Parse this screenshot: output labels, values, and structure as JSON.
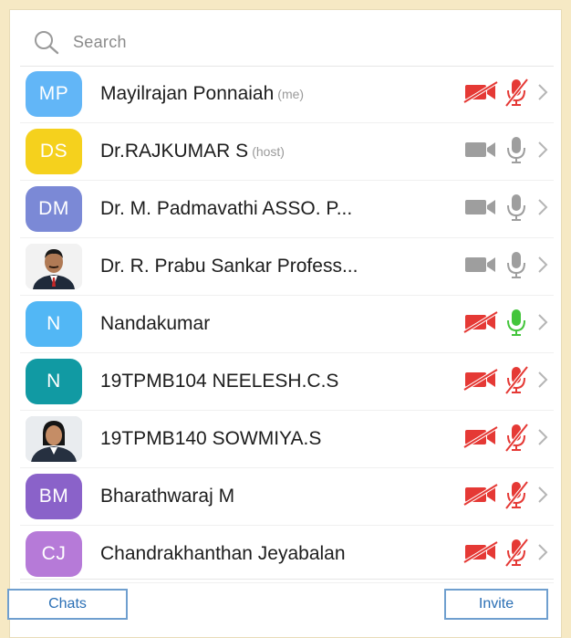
{
  "search": {
    "placeholder": "Search"
  },
  "participants": [
    {
      "initials": "MP",
      "name": "Mayilrajan Ponnaiah",
      "tag": "(me)",
      "avatar_color": "#62b6f7",
      "avatar_type": "initials",
      "video": "off",
      "audio": "muted"
    },
    {
      "initials": "DS",
      "name": "Dr.RAJKUMAR S",
      "tag": "(host)",
      "avatar_color": "#f5d11d",
      "avatar_type": "initials",
      "video": "idle",
      "audio": "idle"
    },
    {
      "initials": "DM",
      "name": "Dr. M. Padmavathi ASSO. P...",
      "tag": "",
      "avatar_color": "#7b89d6",
      "avatar_type": "initials",
      "video": "idle",
      "audio": "idle"
    },
    {
      "initials": "",
      "name": "Dr. R. Prabu Sankar Profess...",
      "tag": "",
      "avatar_color": "#eeeeee",
      "avatar_type": "photo-man",
      "video": "idle",
      "audio": "idle"
    },
    {
      "initials": "N",
      "name": "Nandakumar",
      "tag": "",
      "avatar_color": "#52b7f5",
      "avatar_type": "initials",
      "video": "off",
      "audio": "active"
    },
    {
      "initials": "N",
      "name": "19TPMB104 NEELESH.C.S",
      "tag": "",
      "avatar_color": "#119aa3",
      "avatar_type": "initials",
      "video": "off",
      "audio": "muted"
    },
    {
      "initials": "",
      "name": "19TPMB140 SOWMIYA.S",
      "tag": "",
      "avatar_color": "#dddddd",
      "avatar_type": "photo-woman",
      "video": "off",
      "audio": "muted"
    },
    {
      "initials": "BM",
      "name": "Bharathwaraj M",
      "tag": "",
      "avatar_color": "#8a62c9",
      "avatar_type": "initials",
      "video": "off",
      "audio": "muted"
    },
    {
      "initials": "CJ",
      "name": "Chandrakhanthan Jeyabalan",
      "tag": "",
      "avatar_color": "#b67ad8",
      "avatar_type": "initials",
      "video": "off",
      "audio": "muted"
    }
  ],
  "footer": {
    "chats_label": "Chats",
    "invite_label": "Invite"
  },
  "colors": {
    "muted": "#e53935",
    "idle": "#9e9e9e",
    "active": "#43c53b",
    "button": "#2a6fb5"
  },
  "icons": {
    "search": "search-icon",
    "video": "video-camera-icon",
    "mic": "microphone-icon",
    "chevron": "chevron-right-icon"
  }
}
